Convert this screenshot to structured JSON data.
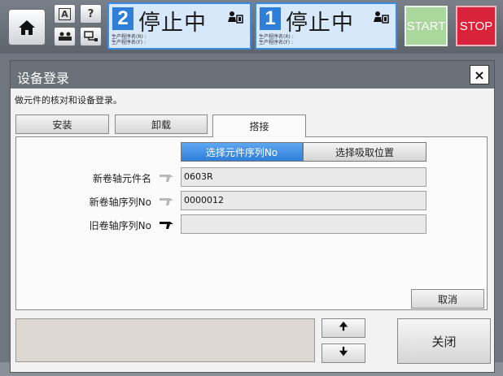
{
  "topbar": {
    "small_buttons": [
      "A",
      "?"
    ],
    "lane2": {
      "number": "2",
      "state": "停止中",
      "line1": "生产程序名(R) :",
      "line2": "生产程序名(F) :"
    },
    "lane1": {
      "number": "1",
      "state": "停止中",
      "line1": "生产程序名(R) :",
      "line2": "生产程序名(F) :"
    },
    "start_label": "START",
    "stop_label": "STOP"
  },
  "dialog": {
    "title": "设备登录",
    "close_label": "×",
    "description": "做元件的核对和设备登录。",
    "tabs": [
      {
        "label": "安装"
      },
      {
        "label": "卸载"
      },
      {
        "label": "搭接"
      }
    ],
    "subtabs": [
      {
        "label": "选择元件序列No"
      },
      {
        "label": "选择吸取位置"
      }
    ],
    "fields": [
      {
        "label": "新卷轴元件名",
        "value": "0603R"
      },
      {
        "label": "新卷轴序列No",
        "value": "0000012"
      },
      {
        "label": "旧卷轴序列No",
        "value": ""
      }
    ],
    "cancel_label": "取消",
    "up_arrow": "🠉",
    "down_arrow": "🠋",
    "close_button_label": "关闭"
  }
}
